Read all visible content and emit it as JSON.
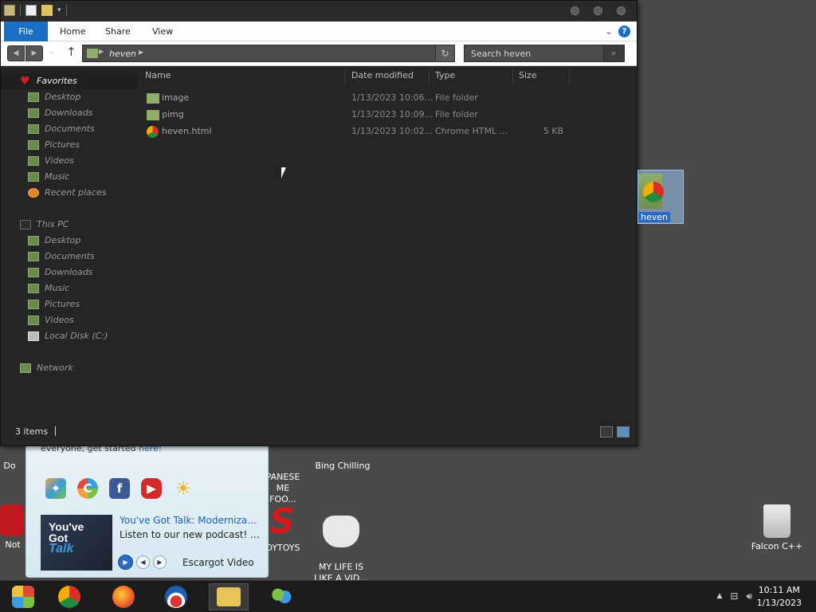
{
  "explorer": {
    "ribbon_tabs": [
      "File",
      "Home",
      "Share",
      "View"
    ],
    "address": {
      "crumb": "heven"
    },
    "search": {
      "placeholder": "Search heven"
    },
    "columns": {
      "name": "Name",
      "date": "Date modified",
      "type": "Type",
      "size": "Size"
    },
    "nav": {
      "favorites_label": "Favorites",
      "favorites": [
        "Desktop",
        "Downloads",
        "Documents",
        "Pictures",
        "Videos",
        "Music",
        "Recent places"
      ],
      "this_pc_label": "This PC",
      "this_pc": [
        "Desktop",
        "Documents",
        "Downloads",
        "Music",
        "Pictures",
        "Videos",
        "Local Disk (C:)"
      ],
      "network_label": "Network"
    },
    "files": [
      {
        "name": "image",
        "date": "1/13/2023 10:06...",
        "type": "File folder",
        "size": ""
      },
      {
        "name": "pimg",
        "date": "1/13/2023 10:09...",
        "type": "File folder",
        "size": ""
      },
      {
        "name": "heven.html",
        "date": "1/13/2023 10:02...",
        "type": "Chrome HTML ...",
        "size": "5 KB"
      }
    ],
    "status": {
      "count": "3 items"
    }
  },
  "drag_item": {
    "label": "heven"
  },
  "desktop_icons": {
    "bing": "Bing Chilling",
    "japanese": "PANESE\nME FOO...",
    "toys": "DYTOYS",
    "life": "MY LIFE IS\nLIKE A VID...",
    "falcon": "Falcon C++",
    "not": "Not",
    "do": "Do"
  },
  "widget": {
    "top_text": "everyone, get started ",
    "top_link": "here!",
    "podcast_title": "You've Got Talk: Moderniza...",
    "podcast_sub": "Listen to our new podcast! ...",
    "thumb_line1": "You've",
    "thumb_line2": "Got",
    "thumb_line3": "Talk",
    "player_label": "Escargot Video"
  },
  "clock": {
    "time": "10:11 AM",
    "date": "1/13/2023"
  },
  "colors": {
    "accent": "#1a6fc4",
    "folder": "#8fae6a"
  }
}
